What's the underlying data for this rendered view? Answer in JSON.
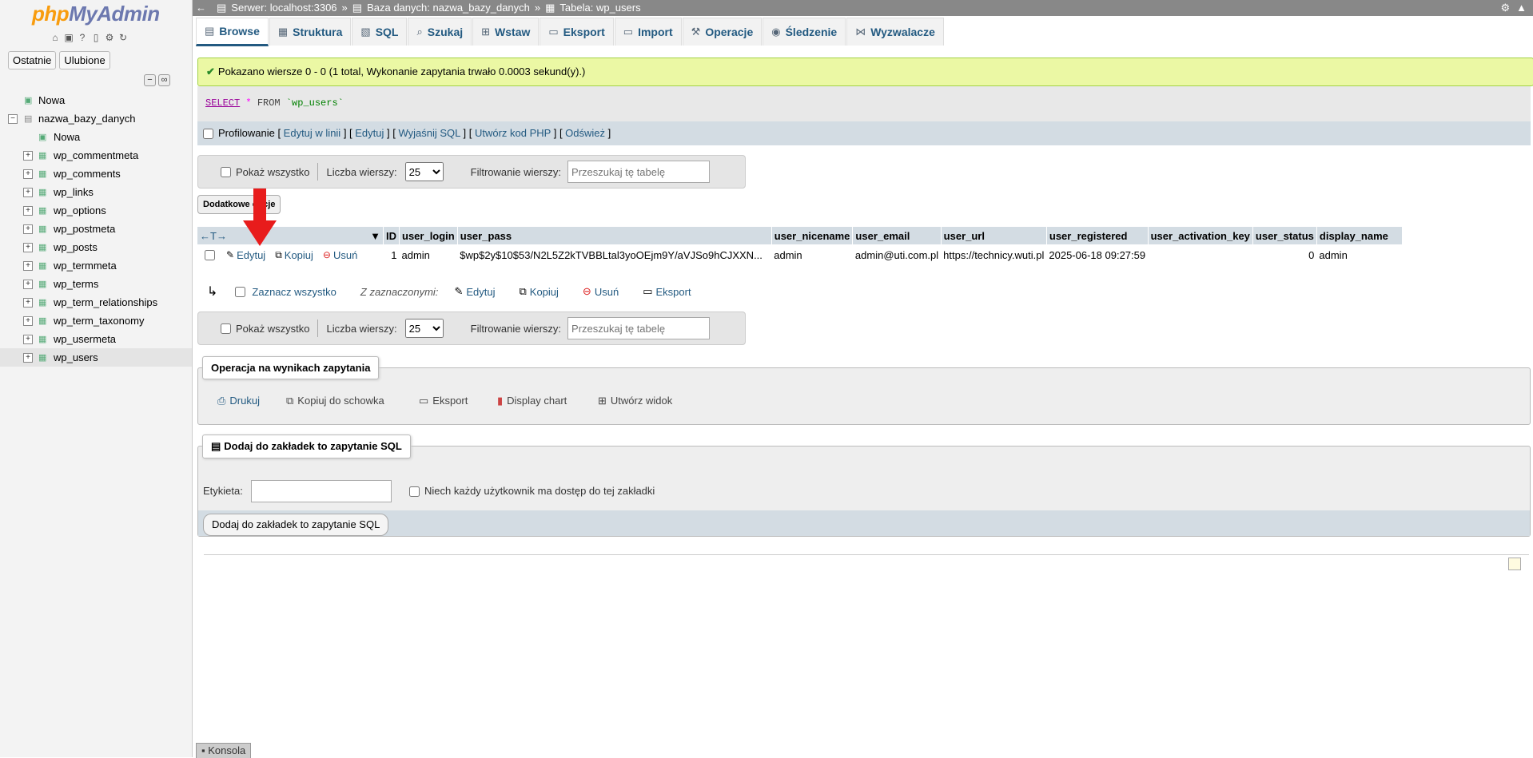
{
  "sidebar": {
    "logo_php": "php",
    "logo_myadmin": "MyAdmin",
    "tab_recent": "Ostatnie",
    "tab_favorites": "Ulubione",
    "tree": {
      "new_root": "Nowa",
      "db": "nazwa_bazy_danych",
      "new_db": "Nowa",
      "tables": [
        "wp_commentmeta",
        "wp_comments",
        "wp_links",
        "wp_options",
        "wp_postmeta",
        "wp_posts",
        "wp_termmeta",
        "wp_terms",
        "wp_term_relationships",
        "wp_term_taxonomy",
        "wp_usermeta",
        "wp_users"
      ]
    }
  },
  "breadcrumb": {
    "server": "Serwer: localhost:3306",
    "database": "Baza danych: nazwa_bazy_danych",
    "table": "Tabela: wp_users",
    "sep": "»"
  },
  "tabs": [
    "Browse",
    "Struktura",
    "SQL",
    "Szukaj",
    "Wstaw",
    "Eksport",
    "Import",
    "Operacje",
    "Śledzenie",
    "Wyzwalacze"
  ],
  "success_message": "Pokazano wiersze 0 - 0 (1 total, Wykonanie zapytania trwało 0.0003 sekund(y).)",
  "sql": {
    "kw1": "SELECT",
    "star": "*",
    "kw2": "FROM",
    "table": "`wp_users`"
  },
  "profile_bar": {
    "label": "Profilowanie",
    "links": [
      "Edytuj w linii",
      "Edytuj",
      "Wyjaśnij SQL",
      "Utwórz kod PHP",
      "Odśwież"
    ]
  },
  "filter": {
    "show_all": "Pokaż wszystko",
    "rows_label": "Liczba wierszy:",
    "rows_value": "25",
    "filter_label": "Filtrowanie wierszy:",
    "filter_placeholder": "Przeszukaj tę tabelę"
  },
  "extra_options": "Dodatkowe opcje",
  "table": {
    "headers": [
      "ID",
      "user_login",
      "user_pass",
      "user_nicename",
      "user_email",
      "user_url",
      "user_registered",
      "user_activation_key",
      "user_status",
      "display_name"
    ],
    "row": {
      "edit": "Edytuj",
      "copy": "Kopiuj",
      "delete": "Usuń",
      "id": "1",
      "user_login": "admin",
      "user_pass": "$wp$2y$10$53/N2L5Z2kTVBBLtal3yoOEjm9Y/aVJSo9hCJXXN...",
      "user_nicename": "admin",
      "user_email": "admin@uti.com.pl",
      "user_url": "https://technicy.wuti.pl",
      "user_registered": "2025-06-18 09:27:59",
      "user_activation_key": "",
      "user_status": "0",
      "display_name": "admin"
    }
  },
  "bulk": {
    "select_all": "Zaznacz wszystko",
    "with_selected": "Z zaznaczonymi:",
    "edit": "Edytuj",
    "copy": "Kopiuj",
    "delete": "Usuń",
    "export": "Eksport"
  },
  "ops": {
    "legend": "Operacja na wynikach zapytania",
    "print": "Drukuj",
    "clipboard": "Kopiuj do schowka",
    "export": "Eksport",
    "chart": "Display chart",
    "view": "Utwórz widok"
  },
  "bookmark": {
    "legend": "Dodaj do zakładek to zapytanie SQL",
    "label": "Etykieta:",
    "shared": "Niech każdy użytkownik ma dostęp do tej zakładki",
    "submit": "Dodaj do zakładek to zapytanie SQL"
  },
  "console": "Konsola"
}
